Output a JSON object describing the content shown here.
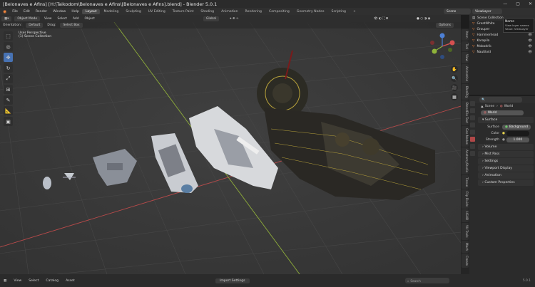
{
  "window": {
    "title": "[Belonaves e Afins] [H:\\Taikodom\\Belonaves e Afins\\[Belonaves e Afins].blend] - Blender 5.0.1",
    "controls": [
      "—",
      "▢",
      "✕"
    ]
  },
  "topbar": {
    "menus": [
      "File",
      "Edit",
      "Render",
      "Window",
      "Help"
    ],
    "workspaces": [
      "Layout",
      "Modeling",
      "Sculpting",
      "UV Editing",
      "Texture Paint",
      "Shading",
      "Animation",
      "Rendering",
      "Compositing",
      "Geometry Nodes",
      "Scripting",
      "+"
    ],
    "active_workspace": "Layout",
    "scene": "Scene",
    "view_layer": "ViewLayer"
  },
  "viewport_header": {
    "mode": "Object Mode",
    "menus": [
      "View",
      "Select",
      "Add",
      "Object"
    ],
    "transform_orientation": "Global",
    "options_label": "Options"
  },
  "tool_header": {
    "orientation_label": "Orientation:",
    "orientation_value": "Default",
    "drag_label": "Drag:",
    "drag_value": "Select Box"
  },
  "viewport": {
    "view_name": "User Perspective",
    "collection": "(1) Scene Collection"
  },
  "toolbar": {
    "tools": [
      {
        "name": "select-box-tool",
        "glyph": "⬚"
      },
      {
        "name": "cursor-tool",
        "glyph": "◎"
      },
      {
        "name": "move-tool",
        "glyph": "✥"
      },
      {
        "name": "rotate-tool",
        "glyph": "↻"
      },
      {
        "name": "scale-tool",
        "glyph": "⤢"
      },
      {
        "name": "transform-tool",
        "glyph": "⊞"
      },
      {
        "name": "annotate-tool",
        "glyph": "✎"
      },
      {
        "name": "measure-tool",
        "glyph": "📐"
      },
      {
        "name": "add-cube-tool",
        "glyph": "▣"
      }
    ]
  },
  "nav_buttons": [
    "✋",
    "🔍",
    "🎥",
    "▦"
  ],
  "side_tabs": [
    "Item",
    "Tool",
    "View",
    "Animation",
    "BlenRig",
    "BlendFile Text",
    "Geo Nodes",
    "AnatomyStudio",
    "Tissue",
    "Flip Fluids",
    "HSHD",
    "VU Tools",
    "Mech",
    "Create"
  ],
  "outliner": {
    "title": "Scene Collection",
    "tooltip": {
      "name": "Name",
      "desc": "View layer names",
      "value": "Value: ViewLayer"
    },
    "items": [
      "GreatWhite",
      "Grouper",
      "Hammerhead",
      "Karapila",
      "Mobodrik",
      "Nautiloid"
    ]
  },
  "properties": {
    "scene": "Scene",
    "world_tab": "World",
    "world_name": "World",
    "surface_header": "Surface",
    "surface_label": "Surface",
    "surface_value": "Background",
    "color_label": "Color",
    "strength_label": "Strength",
    "strength_value": "1.000",
    "sections": [
      "Volume",
      "Mist Pass",
      "Settings",
      "Viewport Display",
      "Animation",
      "Custom Properties"
    ]
  },
  "statusbar": {
    "menus": [
      "View",
      "Select",
      "Catalog",
      "Asset"
    ],
    "import_settings": "Import Settings",
    "search_placeholder": "Search",
    "version": "5.0.1"
  },
  "colors": {
    "accent": "#4772b3",
    "grid_bg": "#3a3a3a",
    "x_axis": "#b84a4a",
    "y_axis": "#8fae3a",
    "collection_orange": "#ff8a3d"
  }
}
